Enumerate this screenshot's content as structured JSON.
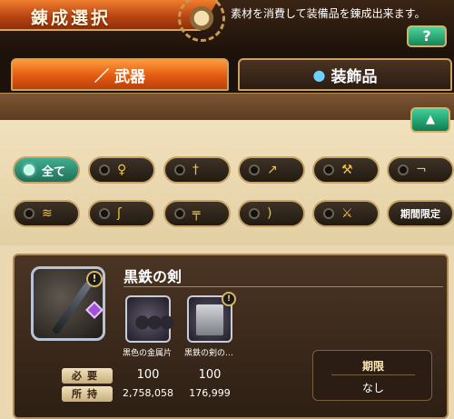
{
  "header": {
    "title": "錬成選択",
    "description": "素材を消費して装備品を錬成出来ます。",
    "help_label": "?"
  },
  "tabs": [
    {
      "label": "武器",
      "icon": "sword-icon",
      "active": true
    },
    {
      "label": "装飾品",
      "icon": "amulet-icon",
      "active": false
    }
  ],
  "filters": {
    "collapse_icon": "▲",
    "all_label": "全て",
    "limited_label": "期間限定",
    "row1_icons": [
      "staff-icon",
      "sword-icon",
      "spear-icon",
      "hammer-sword-icon",
      "gun-icon"
    ],
    "row2_icons": [
      "claw-icon",
      "scythe-icon",
      "mace-icon",
      "bow-icon",
      "axe-icon"
    ]
  },
  "item": {
    "name": "黒鉄の剣",
    "materials": [
      {
        "label": "黒色の金属片",
        "required": "100",
        "owned": "2,758,058"
      },
      {
        "label": "黒鉄の剣の…",
        "required": "100",
        "owned": "176,999"
      }
    ],
    "required_label": "必要",
    "owned_label": "所持",
    "limit_title": "期限",
    "limit_value": "なし"
  },
  "colors": {
    "accent_orange": "#e35a10",
    "accent_green": "#13865a",
    "gold_border": "#caa25f"
  }
}
